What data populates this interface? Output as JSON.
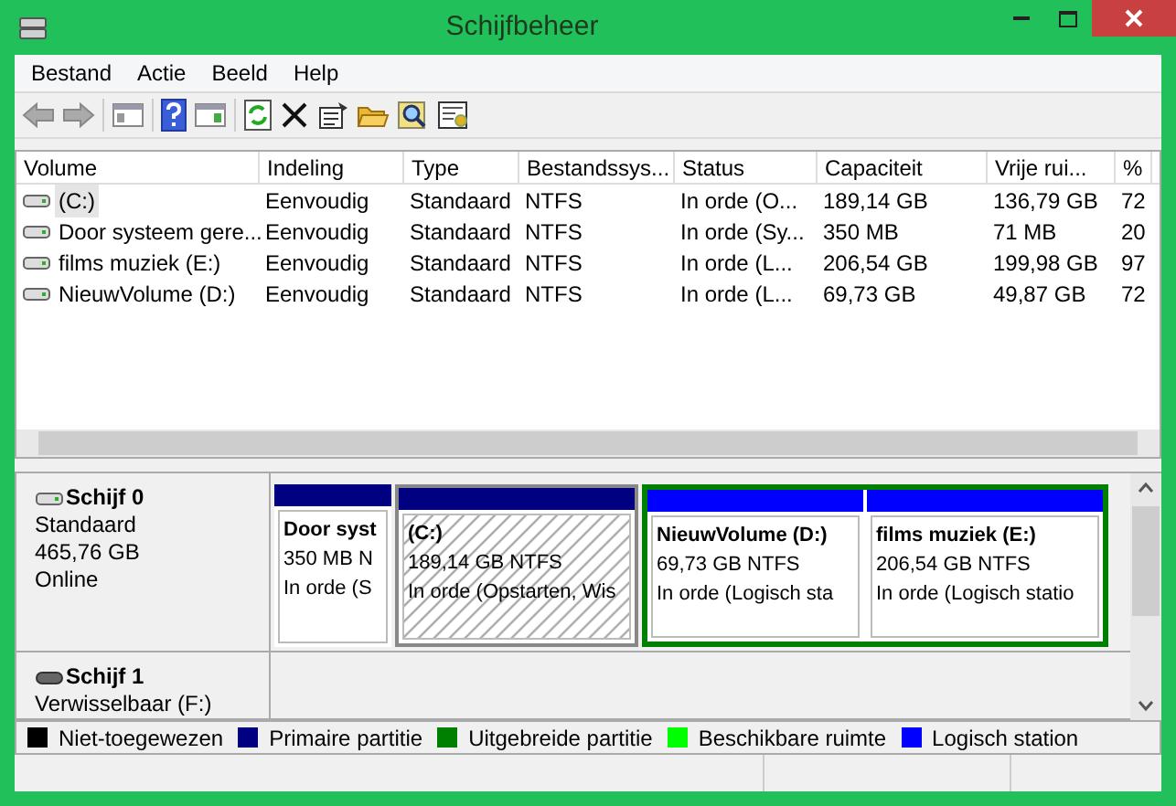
{
  "window": {
    "title": "Schijfbeheer"
  },
  "menu": [
    "Bestand",
    "Actie",
    "Beeld",
    "Help"
  ],
  "volume_table": {
    "columns": [
      "Volume",
      "Indeling",
      "Type",
      "Bestandssys...",
      "Status",
      "Capaciteit",
      "Vrije rui...",
      "%"
    ],
    "rows": [
      {
        "selected": true,
        "cells": [
          "(C:)",
          "Eenvoudig",
          "Standaard",
          "NTFS",
          "In orde (O...",
          "189,14 GB",
          "136,79 GB",
          "72"
        ]
      },
      {
        "selected": false,
        "cells": [
          "Door systeem gere...",
          "Eenvoudig",
          "Standaard",
          "NTFS",
          "In orde (Sy...",
          "350 MB",
          "71 MB",
          "20"
        ]
      },
      {
        "selected": false,
        "cells": [
          "films muziek (E:)",
          "Eenvoudig",
          "Standaard",
          "NTFS",
          "In orde (L...",
          "206,54 GB",
          "199,98 GB",
          "97"
        ]
      },
      {
        "selected": false,
        "cells": [
          "NieuwVolume (D:)",
          "Eenvoudig",
          "Standaard",
          "NTFS",
          "In orde (L...",
          "69,73 GB",
          "49,87 GB",
          "72"
        ]
      }
    ]
  },
  "disks": [
    {
      "name": "Schijf 0",
      "details": [
        "Standaard",
        "465,76 GB",
        "Online"
      ],
      "partitions": [
        {
          "kind": "primary",
          "selected": false,
          "title": "Door syst",
          "lines": [
            "350 MB N",
            "In orde (S"
          ]
        },
        {
          "kind": "primary",
          "selected": true,
          "title": "(C:)",
          "lines": [
            "189,14 GB NTFS",
            "In orde (Opstarten, Wis"
          ]
        },
        {
          "kind": "extended",
          "children": [
            {
              "kind": "logical",
              "selected": false,
              "title": "NieuwVolume  (D:)",
              "lines": [
                "69,73 GB NTFS",
                "In orde (Logisch sta"
              ]
            },
            {
              "kind": "logical",
              "selected": false,
              "title": "films muziek  (E:)",
              "lines": [
                "206,54 GB NTFS",
                "In orde (Logisch statio"
              ]
            }
          ]
        }
      ]
    },
    {
      "name": "Schijf 1",
      "details": [
        "Verwisselbaar (F:)"
      ]
    }
  ],
  "legend": [
    {
      "label": "Niet-toegewezen",
      "color": "#000000"
    },
    {
      "label": "Primaire partitie",
      "color": "#000080"
    },
    {
      "label": "Uitgebreide partitie",
      "color": "#008000"
    },
    {
      "label": "Beschikbare ruimte",
      "color": "#00ff00"
    },
    {
      "label": "Logisch station",
      "color": "#0000ff"
    }
  ]
}
